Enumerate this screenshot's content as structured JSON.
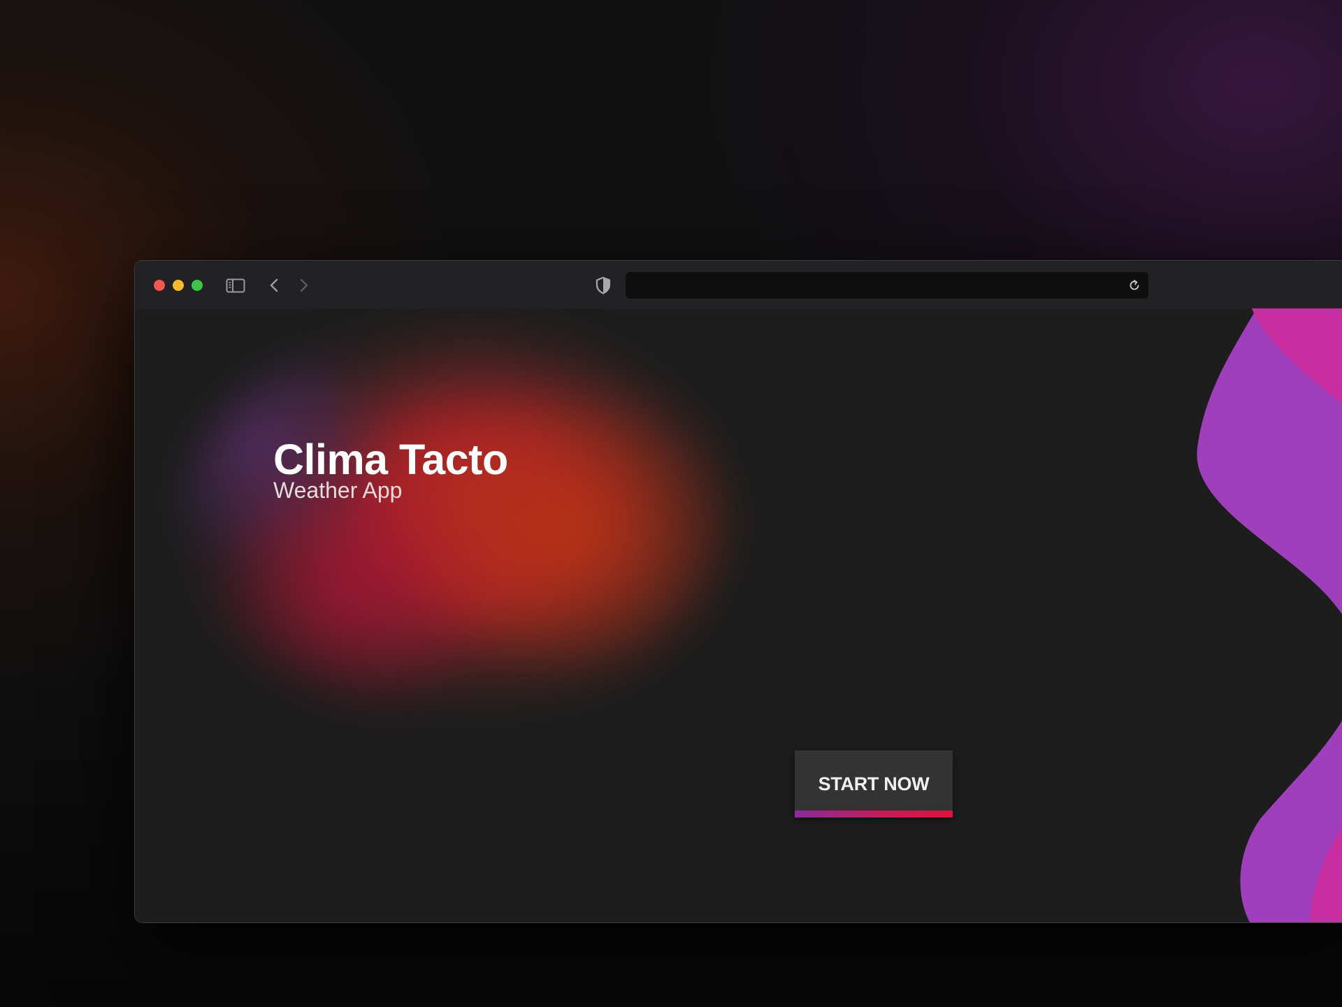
{
  "browser": {
    "address_value": "",
    "icons": {
      "close": "close-dot",
      "minimize": "minimize-dot",
      "maximize": "maximize-dot",
      "sidebar": "sidebar-toggle-icon",
      "back": "chevron-left-icon",
      "forward": "chevron-right-icon",
      "privacy": "shield-icon",
      "reload": "reload-icon"
    }
  },
  "hero": {
    "title": "Clima Tacto",
    "subtitle": "Weather App",
    "cta_label": "START NOW"
  },
  "colors": {
    "page_bg": "#1d1d1d",
    "titlebar_bg": "#222224",
    "address_bg": "#0e0e0f",
    "button_bg": "#333333",
    "accent_purple": "#a03fbb",
    "accent_magenta": "#c82ea0",
    "accent_pink": "#e8166e",
    "blob_red": "#b32a22",
    "traffic_red": "#f0574f",
    "traffic_yellow": "#f4bb2f",
    "traffic_green": "#3fc64a"
  }
}
